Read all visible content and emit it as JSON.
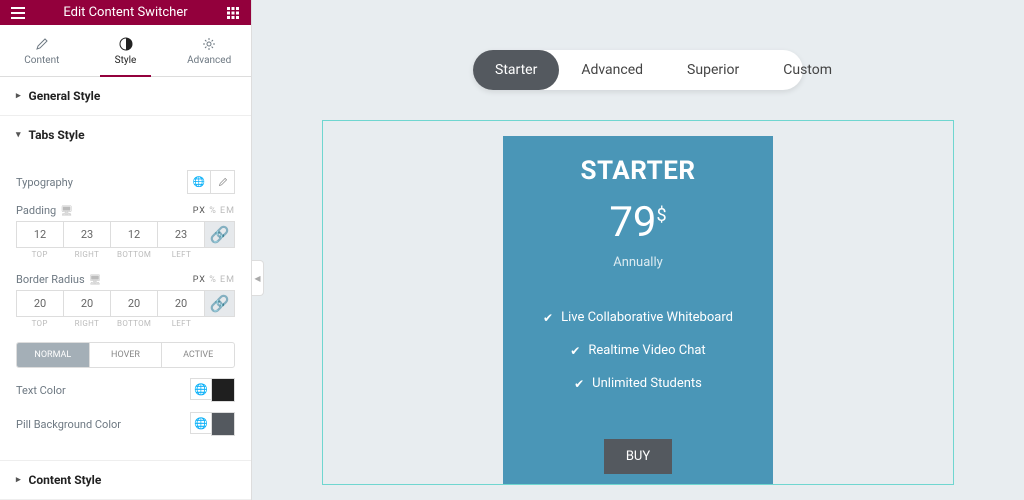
{
  "header": {
    "title": "Edit Content Switcher"
  },
  "tabs": {
    "content": "Content",
    "style": "Style",
    "advanced": "Advanced"
  },
  "sections": {
    "general": "General Style",
    "tabsStyle": "Tabs Style",
    "contentStyle": "Content Style"
  },
  "controls": {
    "typography": "Typography",
    "padding": "Padding",
    "borderRadius": "Border Radius",
    "unitsPx": "PX",
    "unitsPct": "%",
    "unitsEm": "EM",
    "dimLabels": {
      "top": "TOP",
      "right": "RIGHT",
      "bottom": "BOTTOM",
      "left": "LEFT"
    },
    "paddingVals": {
      "top": "12",
      "right": "23",
      "bottom": "12",
      "left": "23"
    },
    "radiusVals": {
      "top": "20",
      "right": "20",
      "bottom": "20",
      "left": "20"
    },
    "states": {
      "normal": "NORMAL",
      "hover": "HOVER",
      "active": "ACTIVE"
    },
    "textColor": "Text Color",
    "pillBg": "Pill Background Color"
  },
  "preview": {
    "tabs": [
      "Starter",
      "Advanced",
      "Superior",
      "Custom"
    ],
    "card": {
      "title": "STARTER",
      "price": "79",
      "currency": "$",
      "period": "Annually",
      "features": [
        "Live Collaborative Whiteboard",
        "Realtime Video Chat",
        "Unlimited Students"
      ],
      "cta": "BUY"
    }
  }
}
